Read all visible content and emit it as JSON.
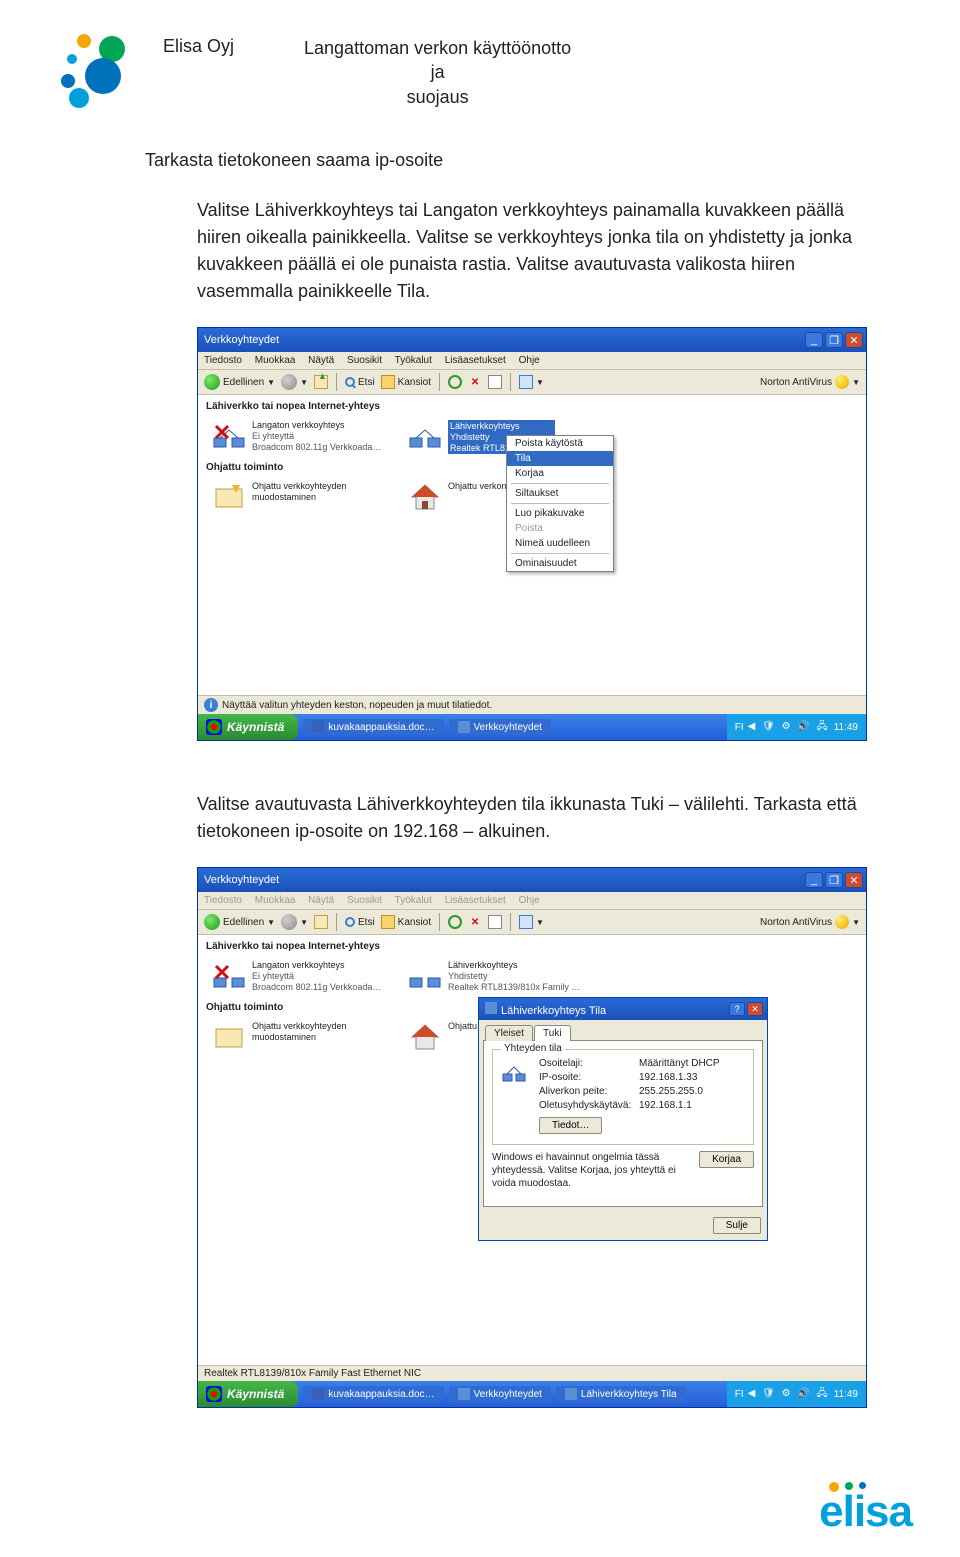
{
  "header": {
    "company": "Elisa Oyj",
    "doc_title_l1": "Langattoman verkon käyttöönotto",
    "doc_title_l2": "ja",
    "doc_title_l3": "suojaus"
  },
  "section_heading": "Tarkasta tietokoneen saama ip-osoite",
  "paragraph1": "Valitse Lähiverkkoyhteys tai Langaton verkkoyhteys painamalla kuvakkeen päällä hiiren oikealla painikkeella. Valitse se verkkoyhteys jonka tila on yhdistetty ja jonka kuvakkeen päällä ei ole punaista rastia. Valitse avautuvasta valikosta hiiren vasemmalla painikkeelle Tila.",
  "paragraph2": "Valitse avautuvasta Lähiverkkoyhteyden tila ikkunasta Tuki – välilehti. Tarkasta että tietokoneen ip-osoite on 192.168 – alkuinen.",
  "win_common": {
    "title": "Verkkoyhteydet",
    "menus": [
      "Tiedosto",
      "Muokkaa",
      "Näytä",
      "Suosikit",
      "Työkalut",
      "Lisäasetukset",
      "Ohje"
    ],
    "back": "Edellinen",
    "search": "Etsi",
    "folders": "Kansiot",
    "norton": "Norton AntiVirus",
    "section1": "Lähiverkko tai nopea Internet-yhteys",
    "section2": "Ohjattu toiminto",
    "conn_wlan_name": "Langaton verkkoyhteys",
    "conn_wlan_state": "Ei yhteyttä",
    "conn_wlan_dev": "Broadcom 802.11g Verkkoada…",
    "conn_lan_name": "Lähiverkkoyhteys",
    "conn_lan_state": "Yhdistetty",
    "conn_lan_dev": "Realtek RTL8139/810x …",
    "wiz1": "Ohjattu verkkoyhteyden muodostaminen",
    "wiz2": "Ohjattu verkon asennu…",
    "start": "Käynnistä",
    "task1": "kuvakaappauksia.doc…",
    "task2": "Verkkoyhteydet",
    "lang": "FI",
    "clock": "11:49"
  },
  "ctx": {
    "i1": "Poista käytöstä",
    "i2": "Tila",
    "i3": "Korjaa",
    "i4": "Siltaukset",
    "i5": "Luo pikakuvake",
    "i6": "Poista",
    "i7": "Nimeä uudelleen",
    "i8": "Ominaisuudet"
  },
  "win1_status": "Näyttää valitun yhteyden keston, nopeuden ja muut tilatiedot.",
  "win2_status": "Realtek RTL8139/810x Family Fast Ethernet NIC",
  "win2": {
    "conn_lan_dev": "Realtek RTL8139/810x Family …",
    "wiz2_trunc": "Ohjattu…",
    "task3": "Lähiverkkoyhteys Tila"
  },
  "dlg": {
    "title": "Lähiverkkoyhteys Tila",
    "tab1": "Yleiset",
    "tab2": "Tuki",
    "group": "Yhteyden tila",
    "l_type": "Osoitelaji:",
    "v_type": "Määrittänyt DHCP",
    "l_ip": "IP-osoite:",
    "v_ip": "192.168.1.33",
    "l_mask": "Aliverkon peite:",
    "v_mask": "255.255.255.0",
    "l_gw": "Oletusyhdyskäytävä:",
    "v_gw": "192.168.1.1",
    "btn_details": "Tiedot…",
    "msg": "Windows ei havainnut ongelmia tässä yhteydessä. Valitse Korjaa, jos yhteyttä ei voida muodostaa.",
    "btn_repair": "Korjaa",
    "btn_close": "Sulje"
  },
  "footer_logo": "elisa"
}
